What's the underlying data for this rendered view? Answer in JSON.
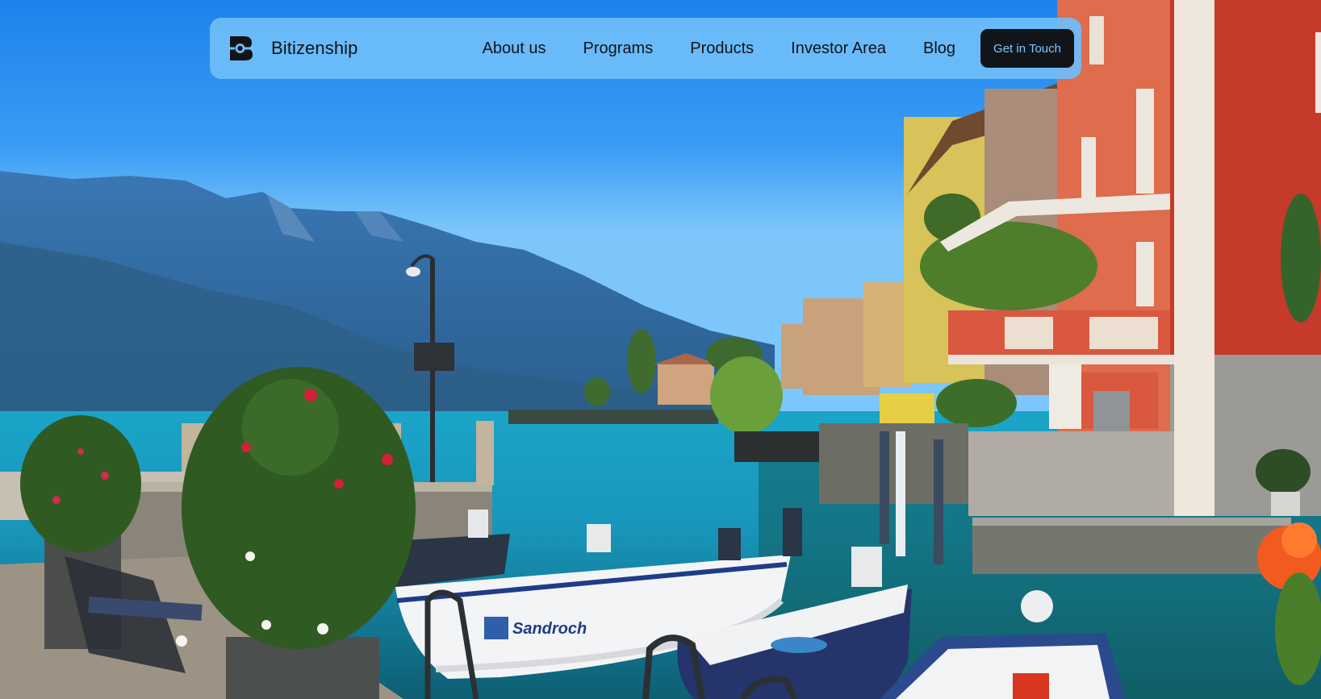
{
  "brand": {
    "name": "Bitizenship",
    "logo_icon": "bitizenship-logo-icon"
  },
  "nav": {
    "items": [
      {
        "label": "About us"
      },
      {
        "label": "Programs"
      },
      {
        "label": "Products"
      },
      {
        "label": "Investor Area"
      },
      {
        "label": "Blog"
      }
    ],
    "cta_label": "Get in Touch"
  },
  "hero": {
    "boat_name": "Sandroch"
  },
  "colors": {
    "navbar_background": "#6fbefa",
    "cta_background": "#11151a",
    "cta_text": "#7fc6ff",
    "text": "#111418"
  }
}
